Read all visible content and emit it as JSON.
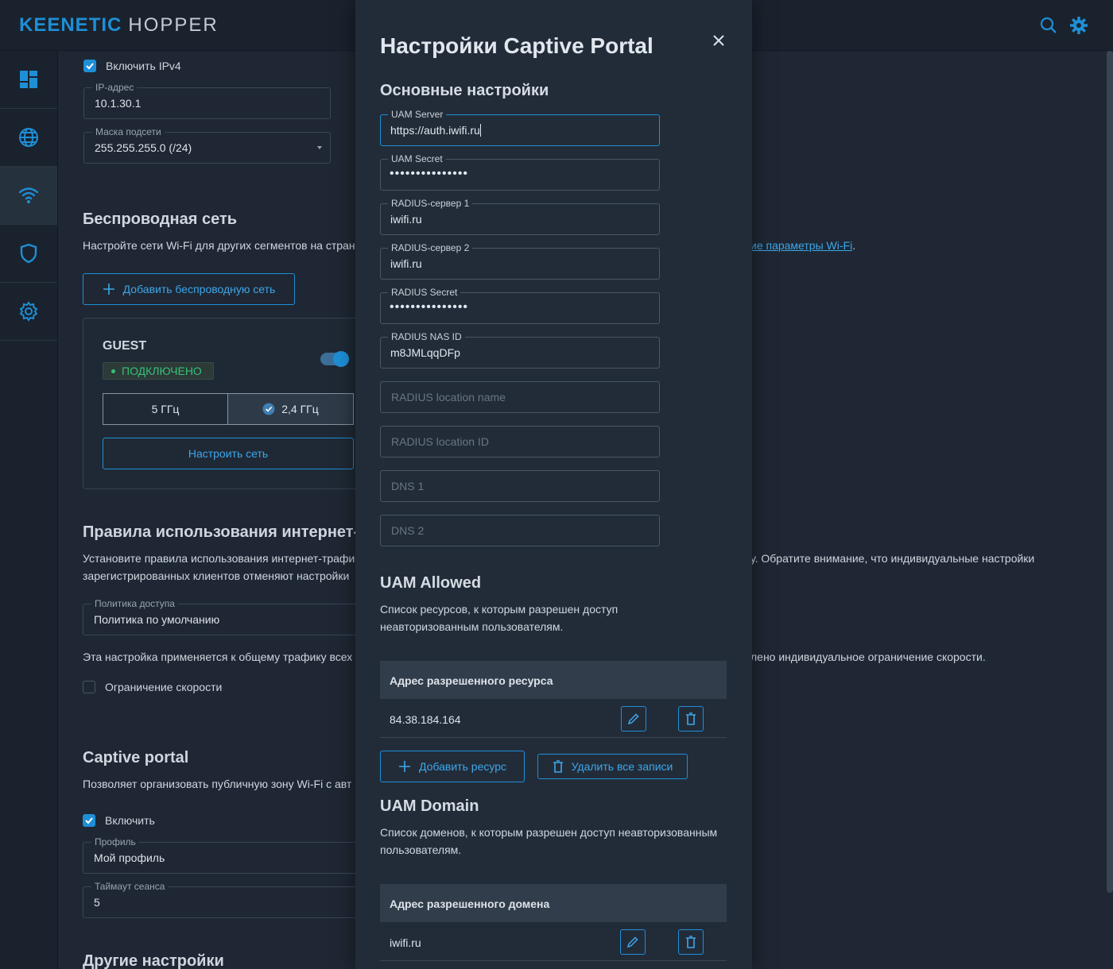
{
  "app": {
    "brand_keenetic": "KEENETIC",
    "brand_hopper": "HOPPER"
  },
  "background": {
    "ipv4_checkbox_label": "Включить IPv4",
    "ip_field": {
      "label": "IP-адрес",
      "value": "10.1.30.1"
    },
    "mask_field": {
      "label": "Маска подсети",
      "value": "255.255.255.0 (/24)"
    },
    "wireless": {
      "title": "Беспроводная сеть",
      "desc_left": "Настройте сети Wi-Fi для других сегментов на стран",
      "desc_link": "ие параметры Wi-Fi",
      "desc_end": ".",
      "add_button": "Добавить беспроводную сеть",
      "card": {
        "name": "GUEST",
        "status": "ПОДКЛЮЧЕНО",
        "band_5": "5 ГГц",
        "band_24": "2,4 ГГц",
        "configure_button": "Настроить сеть"
      }
    },
    "rules": {
      "title": "Правила использования интернет-т",
      "desc_line1_left": "Установите правила использования интернет-трафи",
      "desc_line1_right": "у. Обратите внимание, что индивидуальные настройки",
      "desc_line2_left": "зарегистрированных клиентов отменяют настройки",
      "policy_field": {
        "label": "Политика доступа",
        "value": "Политика по умолчанию"
      },
      "note_left": "Эта настройка применяется к общему трафику всех",
      "note_right": "лено индивидуальное ограничение скорости.",
      "speed_limit_label": "Ограничение скорости"
    },
    "captive": {
      "title": "Captive portal",
      "desc": "Позволяет организовать публичную зону Wi-Fi с авт",
      "enable_label": "Включить",
      "profile_field": {
        "label": "Профиль",
        "value": "Мой профиль"
      },
      "timeout_field": {
        "label": "Таймаут сеанса",
        "value": "5"
      }
    },
    "other_title": "Другие настройки"
  },
  "modal": {
    "title": "Настройки Captive Portal",
    "basic_title": "Основные настройки",
    "fields": {
      "uam_server": {
        "label": "UAM Server",
        "value": "https://auth.iwifi.ru"
      },
      "uam_secret": {
        "label": "UAM Secret",
        "value": "•••••••••••••••"
      },
      "radius1": {
        "label": "RADIUS-сервер 1",
        "value": "iwifi.ru"
      },
      "radius2": {
        "label": "RADIUS-сервер 2",
        "value": "iwifi.ru"
      },
      "radius_secret": {
        "label": "RADIUS Secret",
        "value": "•••••••••••••••"
      },
      "nas_id": {
        "label": "RADIUS NAS ID",
        "value": "m8JMLqqDFp"
      },
      "location_name": {
        "placeholder": "RADIUS location name"
      },
      "location_id": {
        "placeholder": "RADIUS location ID"
      },
      "dns1": {
        "placeholder": "DNS 1"
      },
      "dns2": {
        "placeholder": "DNS 2"
      }
    },
    "uam_allowed": {
      "title": "UAM Allowed",
      "desc": "Список ресурсов, к которым разрешен доступ неавторизованным пользователям.",
      "column": "Адрес разрешенного ресурса",
      "rows": [
        "84.38.184.164"
      ],
      "add_button": "Добавить ресурс",
      "delete_all_button": "Удалить все записи"
    },
    "uam_domain": {
      "title": "UAM Domain",
      "desc": "Список доменов, к которым разрешен доступ неавторизованным пользователям.",
      "column": "Адрес разрешенного домена",
      "rows": [
        "iwifi.ru"
      ]
    }
  },
  "colors": {
    "accent": "#1e8fd6",
    "success": "#36c07a",
    "background": "#1e2733"
  },
  "icons": [
    "search-icon",
    "gear-icon",
    "dashboard-icon",
    "globe-icon",
    "wifi-icon",
    "shield-icon",
    "settings-icon",
    "close-icon",
    "plus-icon",
    "pencil-icon",
    "trash-icon",
    "check-icon"
  ]
}
